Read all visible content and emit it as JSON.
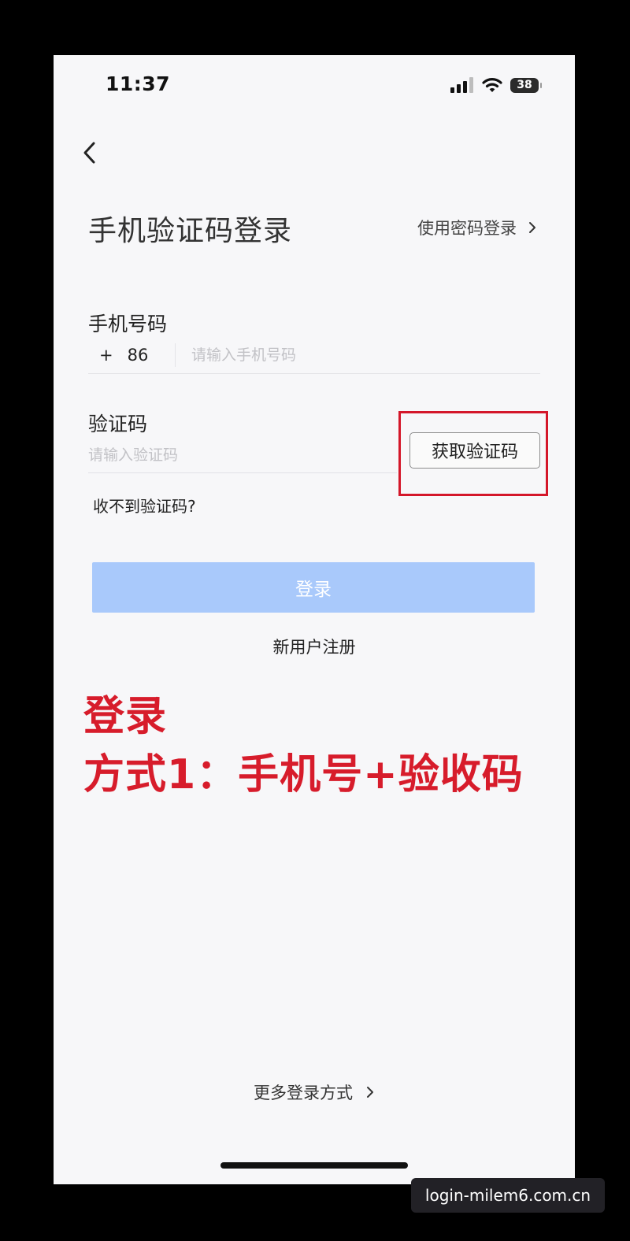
{
  "status_bar": {
    "time": "11:37",
    "battery_level": "38",
    "icons": [
      "cellular-signal-icon",
      "wifi-icon",
      "battery-icon"
    ]
  },
  "nav": {
    "back_icon": "chevron-left-icon"
  },
  "header": {
    "title": "手机验证码登录",
    "password_login_label": "使用密码登录",
    "password_login_icon": "chevron-right-icon"
  },
  "phone_field": {
    "label": "手机号码",
    "country_plus": "+",
    "country_code": "86",
    "value": "",
    "placeholder": "请输入手机号码"
  },
  "code_field": {
    "label": "验证码",
    "value": "",
    "placeholder": "请输入验证码",
    "get_code_label": "获取验证码"
  },
  "no_code_label": "收不到验证码?",
  "login_button_label": "登录",
  "register_label": "新用户注册",
  "annotation": {
    "line1": "登录",
    "line2": "方式1：手机号+验收码",
    "color": "#d71c2b"
  },
  "more_login": {
    "label": "更多登录方式",
    "icon": "chevron-right-icon"
  },
  "watermark": "login-milem6.com.cn",
  "colors": {
    "login_button_bg": "#a9c9fb",
    "highlight_box": "#d4172a",
    "screen_bg": "#f7f7f9"
  }
}
